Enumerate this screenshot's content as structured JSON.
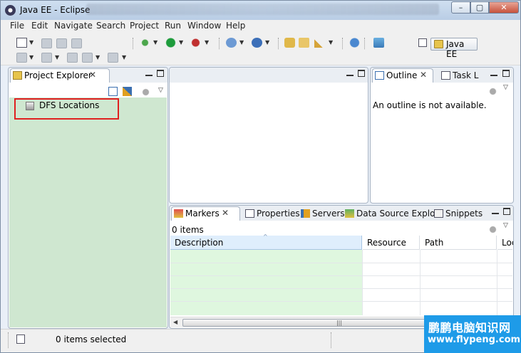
{
  "window": {
    "title": "Java EE - Eclipse",
    "min_glyph": "–",
    "max_glyph": "▢",
    "close_glyph": "✕"
  },
  "menu": [
    "File",
    "Edit",
    "Navigate",
    "Search",
    "Project",
    "Run",
    "Window",
    "Help"
  ],
  "perspective": {
    "label": "Java EE"
  },
  "project_explorer": {
    "tab_label": "Project Explorer",
    "close_glyph": "✕",
    "items": [
      {
        "label": "DFS Locations",
        "icon": "dfs-folder-icon"
      }
    ]
  },
  "outline": {
    "tabs": [
      {
        "label": "Outline",
        "close_glyph": "✕"
      },
      {
        "label": "Task L"
      }
    ],
    "message": "An outline is not available."
  },
  "bottom_panel": {
    "tabs": [
      {
        "label": "Markers",
        "icon": "markers-icon",
        "close_glyph": "✕"
      },
      {
        "label": "Properties",
        "icon": "properties-icon"
      },
      {
        "label": "Servers",
        "icon": "servers-icon"
      },
      {
        "label": "Data Source Explo",
        "icon": "data-source-icon"
      },
      {
        "label": "Snippets",
        "icon": "snippets-icon"
      }
    ],
    "item_count": "0 items",
    "columns": [
      "Description",
      "Resource",
      "Path",
      "Loc"
    ],
    "scroll_grip": "|||"
  },
  "status": {
    "text": "0 items selected"
  },
  "watermark": {
    "line1": "鹏鹏电脑知识网",
    "line2": "www.flypeng.com"
  },
  "colors": {
    "explorer_bg": "#cfe7d0",
    "highlight_box": "#e02020",
    "watermark_bg": "#1e9be8"
  }
}
